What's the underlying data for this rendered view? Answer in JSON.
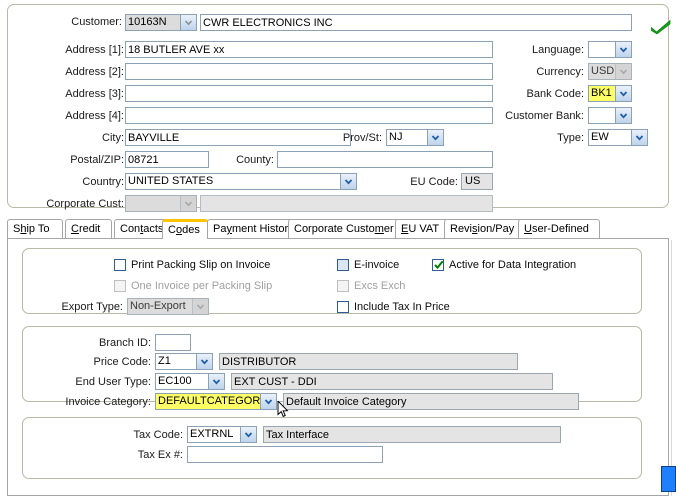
{
  "top_panel": {
    "customer": {
      "label": "Customer:",
      "code": "10163N",
      "name": "CWR ELECTRONICS INC",
      "validated_icon": "green-check-icon"
    },
    "address": {
      "label_1": "Address [1]:",
      "label_2": "Address [2]:",
      "label_3": "Address [3]:",
      "label_4": "Address [4]:",
      "line_1": "18 BUTLER AVE xx",
      "line_2": "",
      "line_3": "",
      "line_4": ""
    },
    "city": {
      "label": "City:",
      "value": "BAYVILLE"
    },
    "prov_st": {
      "label": "Prov/St:",
      "value": "NJ"
    },
    "postal_zip": {
      "label": "Postal/ZIP:",
      "value": "08721"
    },
    "county": {
      "label": "County:",
      "value": ""
    },
    "country": {
      "label": "Country:",
      "value": "UNITED STATES"
    },
    "eu_code": {
      "label": "EU Code:",
      "value": "US"
    },
    "corporate_cust": {
      "label": "Corporate Cust:",
      "code": "",
      "name": ""
    },
    "language": {
      "label": "Language:",
      "value": ""
    },
    "currency": {
      "label": "Currency:",
      "value": "USD"
    },
    "bank_code": {
      "label": "Bank Code:",
      "value": "BK1"
    },
    "customer_bank": {
      "label": "Customer Bank:",
      "value": ""
    },
    "type": {
      "label": "Type:",
      "value": "EW"
    }
  },
  "tabs": [
    {
      "label": "Ship To",
      "pre": "S",
      "mn": "h",
      "post": "ip To",
      "active": false
    },
    {
      "label": "Credit",
      "pre": "",
      "mn": "C",
      "post": "redit",
      "active": false
    },
    {
      "label": "Contacts",
      "pre": "Con",
      "mn": "t",
      "post": "acts",
      "active": false
    },
    {
      "label": "Codes",
      "pre": "C",
      "mn": "o",
      "post": "des",
      "active": true
    },
    {
      "label": "Payment History",
      "pre": "Pa",
      "mn": "y",
      "post": "ment History",
      "active": false
    },
    {
      "label": "Corporate Customer",
      "pre": "Corporate Custo",
      "mn": "m",
      "post": "er",
      "active": false
    },
    {
      "label": "EU VAT",
      "pre": "",
      "mn": "E",
      "post": "U VAT",
      "active": false
    },
    {
      "label": "Revision/Pay",
      "pre": "Revi",
      "mn": "s",
      "post": "ion/Pay",
      "active": false
    },
    {
      "label": "User-Defined",
      "pre": "",
      "mn": "U",
      "post": "ser-Defined",
      "active": false
    }
  ],
  "codes_tab": {
    "group_flags": {
      "print_packing_slip": {
        "label": "Print Packing Slip on Invoice",
        "checked": false,
        "disabled": false
      },
      "one_invoice_per_packing_slip": {
        "label": "One Invoice per Packing Slip",
        "checked": false,
        "disabled": true
      },
      "e_invoice": {
        "label": "E-invoice",
        "checked": false,
        "disabled": false
      },
      "excs_exch": {
        "label": "Excs Exch",
        "checked": false,
        "disabled": true
      },
      "active_for_data_integration": {
        "label": "Active for Data Integration",
        "checked": true,
        "disabled": false
      },
      "include_tax_in_price": {
        "label": "Include Tax In Price",
        "checked": false,
        "disabled": false
      },
      "export_type": {
        "label": "Export Type:",
        "value": "Non-Export",
        "disabled": true
      }
    },
    "group_codes": {
      "branch_id": {
        "label": "Branch ID:",
        "value": ""
      },
      "price_code": {
        "label": "Price Code:",
        "code": "Z1",
        "desc": "DISTRIBUTOR"
      },
      "end_user_type": {
        "label": "End User Type:",
        "code": "EC100",
        "desc": "EXT CUST - DDI"
      },
      "invoice_category": {
        "label": "Invoice Category:",
        "code": "DEFAULTCATEGOR",
        "desc": "Default Invoice Category",
        "highlighted": true
      }
    },
    "group_tax": {
      "tax_code": {
        "label": "Tax Code:",
        "code": "EXTRNL",
        "desc": "Tax Interface"
      },
      "tax_ex_number": {
        "label": "Tax Ex #:",
        "value": ""
      }
    }
  },
  "colors": {
    "highlight_yellow": "#ffff66",
    "active_tab_accent": "#ffc400",
    "check_green": "#008000",
    "combo_arrow_blue": "#1f5fa9",
    "field_border": "#8ba2b5",
    "readonly_grey": "#e4e4e4",
    "blue_nub": "#1e7fff"
  }
}
